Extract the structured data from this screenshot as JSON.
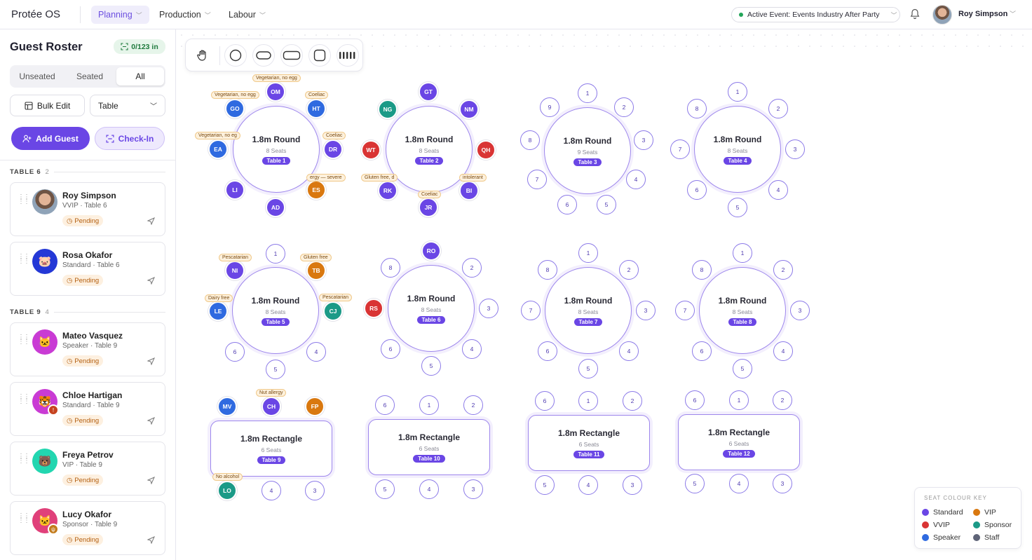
{
  "app": {
    "brand": "Protée OS"
  },
  "nav": {
    "items": [
      {
        "label": "Planning",
        "active": true
      },
      {
        "label": "Production"
      },
      {
        "label": "Labour"
      }
    ]
  },
  "event": {
    "label": "Active Event: Events Industry After Party"
  },
  "user": {
    "name": "Roy Simpson"
  },
  "sidebar": {
    "title": "Guest Roster",
    "checked_in": "0/123 in",
    "filters": [
      "Unseated",
      "Seated",
      "All"
    ],
    "active_filter": "All",
    "bulk_edit": "Bulk Edit",
    "group_by": "Table",
    "add_guest": "Add Guest",
    "check_in": "Check-In",
    "groups": [
      {
        "label": "TABLE 6",
        "count": "2",
        "guests": [
          {
            "name": "Roy Simpson",
            "sub": "VVIP · Table 6",
            "status": "Pending",
            "color": "#8fa3b8",
            "icon": "photo"
          },
          {
            "name": "Rosa Okafor",
            "sub": "Standard · Table 6",
            "status": "Pending",
            "color": "#2438d6",
            "icon": "🐷"
          }
        ]
      },
      {
        "label": "TABLE 9",
        "count": "4",
        "guests": [
          {
            "name": "Mateo Vasquez",
            "sub": "Speaker · Table 9",
            "status": "Pending",
            "color": "#c93bd4",
            "icon": "🐱"
          },
          {
            "name": "Chloe Hartigan",
            "sub": "Standard · Table 9",
            "status": "Pending",
            "color": "#c93bd4",
            "icon": "🐯"
          },
          {
            "name": "Freya Petrov",
            "sub": "VIP · Table 9",
            "status": "Pending",
            "color": "#22d6b0",
            "icon": "🐻"
          },
          {
            "name": "Lucy Okafor",
            "sub": "Sponsor · Table 9",
            "status": "Pending",
            "color": "#e0407a",
            "icon": "🐱"
          }
        ]
      }
    ]
  },
  "tables": [
    {
      "name": "1.8m Round",
      "seats": "8 Seats",
      "label": "Table 1"
    },
    {
      "name": "1.8m Round",
      "seats": "8 Seats",
      "label": "Table 2"
    },
    {
      "name": "1.8m Round",
      "seats": "9 Seats",
      "label": "Table 3"
    },
    {
      "name": "1.8m Round",
      "seats": "8 Seats",
      "label": "Table 4"
    },
    {
      "name": "1.8m Round",
      "seats": "8 Seats",
      "label": "Table 5"
    },
    {
      "name": "1.8m Round",
      "seats": "8 Seats",
      "label": "Table 6"
    },
    {
      "name": "1.8m Round",
      "seats": "8 Seats",
      "label": "Table 7"
    },
    {
      "name": "1.8m Round",
      "seats": "8 Seats",
      "label": "Table 8"
    },
    {
      "name": "1.8m Rectangle",
      "seats": "6 Seats",
      "label": "Table 9"
    },
    {
      "name": "1.8m Rectangle",
      "seats": "6 Seats",
      "label": "Table 10"
    },
    {
      "name": "1.8m Rectangle",
      "seats": "6 Seats",
      "label": "Table 11"
    },
    {
      "name": "1.8m Rectangle",
      "seats": "6 Seats",
      "label": "Table 12"
    }
  ],
  "seat_colors": {
    "standard": "#6a46e5",
    "vvip": "#d93434",
    "speaker": "#2f6ae0",
    "vip": "#d9780f",
    "sponsor": "#1b9a87",
    "staff": "#5f6478"
  },
  "seats": {
    "t1": [
      {
        "text": "OM",
        "cat": "standard",
        "tag": "Vegetarian, no egg"
      },
      {
        "text": "HT",
        "cat": "speaker",
        "tag": "Coeliac"
      },
      {
        "text": "DR",
        "cat": "standard",
        "tag": "Coeliac"
      },
      {
        "text": "ES",
        "cat": "vip",
        "tag": "ergy — severe"
      },
      {
        "text": "AD",
        "cat": "standard"
      },
      {
        "text": "LI",
        "cat": "standard"
      },
      {
        "text": "EA",
        "cat": "speaker",
        "tag": "Vegetarian, no eg"
      },
      {
        "text": "GO",
        "cat": "speaker",
        "tag": "Vegetarian, no egg"
      }
    ],
    "t2": [
      {
        "text": "GT",
        "cat": "standard"
      },
      {
        "text": "NM",
        "cat": "standard"
      },
      {
        "text": "QH",
        "cat": "vvip"
      },
      {
        "text": "BI",
        "cat": "standard",
        "tag": "intolerant"
      },
      {
        "text": "JR",
        "cat": "standard",
        "tag": "Coeliac"
      },
      {
        "text": "RK",
        "cat": "standard",
        "tag": "Gluten free, d"
      },
      {
        "text": "WT",
        "cat": "vvip"
      },
      {
        "text": "NG",
        "cat": "sponsor"
      }
    ],
    "t3": [
      "1",
      "2",
      "3",
      "4",
      "5",
      "6",
      "7",
      "8",
      "9"
    ],
    "t4": [
      "1",
      "2",
      "3",
      "4",
      "5",
      "6",
      "7",
      "8"
    ],
    "t5": [
      {
        "text": "1"
      },
      {
        "text": "TB",
        "cat": "vip",
        "tag": "Gluten free"
      },
      {
        "text": "CJ",
        "cat": "sponsor",
        "tag": "Pescatarian"
      },
      {
        "text": "4"
      },
      {
        "text": "5"
      },
      {
        "text": "6"
      },
      {
        "text": "LE",
        "cat": "speaker",
        "tag": "Dairy free"
      },
      {
        "text": "NI",
        "cat": "standard",
        "tag": "Pescatarian"
      }
    ],
    "t6": [
      {
        "text": "RO",
        "cat": "standard"
      },
      {
        "text": "2"
      },
      {
        "text": "3"
      },
      {
        "text": "4"
      },
      {
        "text": "5"
      },
      {
        "text": "6"
      },
      {
        "text": "RS",
        "cat": "vvip"
      },
      {
        "text": "8"
      }
    ],
    "t7": [
      "1",
      "2",
      "3",
      "4",
      "5",
      "6",
      "7",
      "8"
    ],
    "t8": [
      "1",
      "2",
      "3",
      "4",
      "5",
      "6",
      "7",
      "8"
    ],
    "t9": [
      {
        "text": "CH",
        "cat": "standard",
        "tag": "Nut allergy"
      },
      {
        "text": "FP",
        "cat": "vip"
      },
      {
        "text": "3"
      },
      {
        "text": "4"
      },
      {
        "text": "LO",
        "cat": "sponsor",
        "tag": "No alcohol"
      },
      {
        "text": "MV",
        "cat": "speaker"
      }
    ],
    "t10": [
      "1",
      "2",
      "3",
      "4",
      "5",
      "6"
    ],
    "t11": [
      "1",
      "2",
      "3",
      "4",
      "5",
      "6"
    ],
    "t12": [
      "1",
      "2",
      "3",
      "4",
      "5",
      "6"
    ]
  },
  "key": {
    "title": "SEAT COLOUR KEY",
    "items": [
      {
        "label": "Standard",
        "color": "#6a46e5"
      },
      {
        "label": "VIP",
        "color": "#d9780f"
      },
      {
        "label": "VVIP",
        "color": "#d93434"
      },
      {
        "label": "Sponsor",
        "color": "#1b9a87"
      },
      {
        "label": "Speaker",
        "color": "#2f6ae0"
      },
      {
        "label": "Staff",
        "color": "#5f6478"
      }
    ]
  }
}
